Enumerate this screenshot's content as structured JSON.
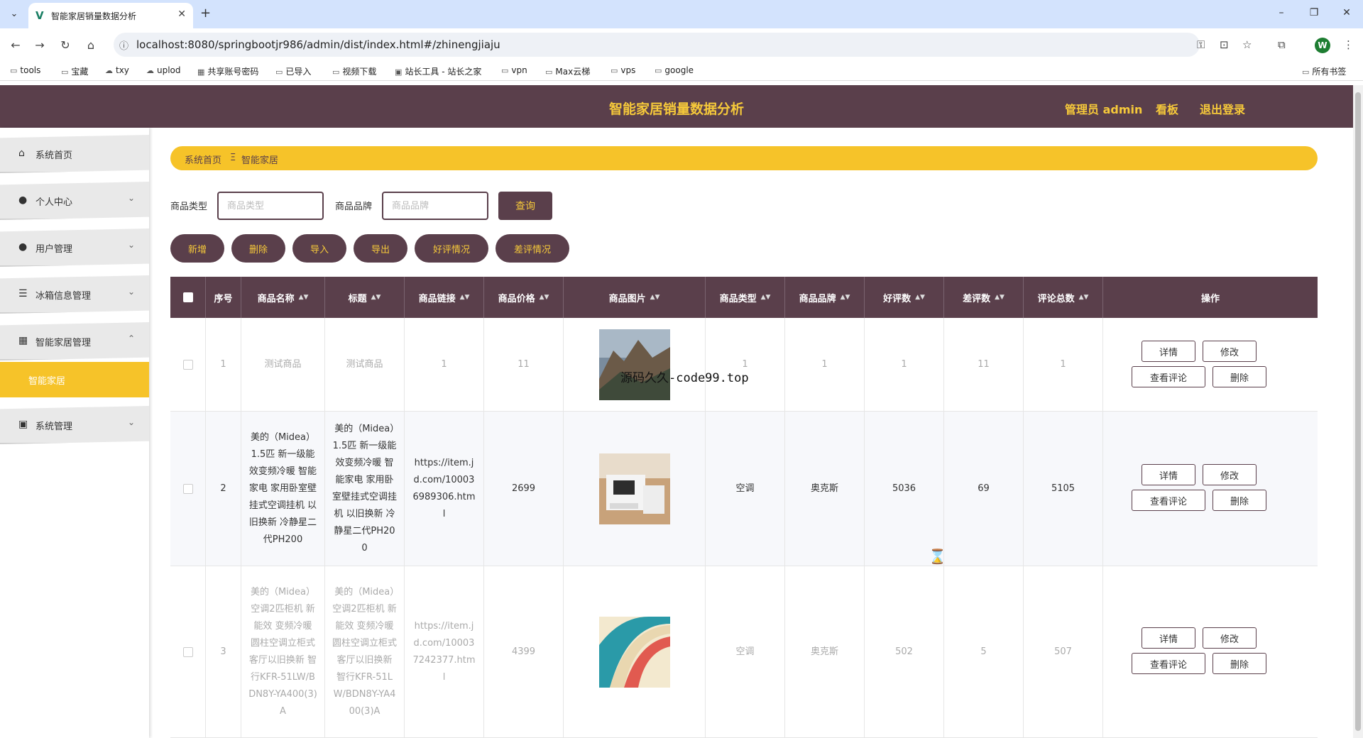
{
  "browser": {
    "tab_title": "智能家居销量数据分析",
    "url": "localhost:8080/springbootjr986/admin/dist/index.html#/zhinengjiaju",
    "profile_initial": "W",
    "bookmarks": [
      "tools",
      "宝藏",
      "txy",
      "uplod",
      "共享账号密码",
      "已导入",
      "视频下载",
      "站长工具 - 站长之家",
      "vpn",
      "Max云梯",
      "vps",
      "google"
    ],
    "all_bookmarks": "所有书签"
  },
  "header": {
    "title": "智能家居销量数据分析",
    "admin_label": "管理员 admin",
    "board_label": "看板",
    "logout_label": "退出登录"
  },
  "sidebar": {
    "items": [
      {
        "label": "系统首页"
      },
      {
        "label": "个人中心"
      },
      {
        "label": "用户管理"
      },
      {
        "label": "冰箱信息管理"
      },
      {
        "label": "智能家居管理"
      },
      {
        "label": "系统管理"
      }
    ],
    "active_sub": "智能家居"
  },
  "breadcrumb": {
    "home": "系统首页",
    "separator": "Ξ",
    "current": "智能家居"
  },
  "search": {
    "type_label": "商品类型",
    "type_placeholder": "商品类型",
    "brand_label": "商品品牌",
    "brand_placeholder": "商品品牌",
    "query_label": "查询"
  },
  "actions": [
    "新增",
    "删除",
    "导入",
    "导出",
    "好评情况",
    "差评情况"
  ],
  "table": {
    "columns": [
      "序号",
      "商品名称",
      "标题",
      "商品链接",
      "商品价格",
      "商品图片",
      "商品类型",
      "商品品牌",
      "好评数",
      "差评数",
      "评论总数",
      "操作"
    ],
    "rows": [
      {
        "index": "1",
        "name": "测试商品",
        "title": "测试商品",
        "link": "1",
        "price": "11",
        "type": "1",
        "brand": "1",
        "good": "1",
        "bad": "11",
        "total": "1"
      },
      {
        "index": "2",
        "name": "美的（Midea）1.5匹 新一级能效变频冷暖 智能家电 家用卧室壁挂式空调挂机 以旧换新 冷静星二代PH200",
        "title": "美的（Midea）1.5匹 新一级能效变频冷暖 智能家电 家用卧室壁挂式空调挂机 以旧换新 冷静星二代PH200",
        "link": "https://item.jd.com/100036989306.html",
        "price": "2699",
        "type": "空调",
        "brand": "奥克斯",
        "good": "5036",
        "bad": "69",
        "total": "5105"
      },
      {
        "index": "3",
        "name": "美的（Midea）空调2匹柜机 新能效 变频冷暖 圆柱空调立柜式 客厅以旧换新 智行KFR-51LW/BDN8Y-YA400(3)A",
        "title": "美的（Midea）空调2匹柜机 新能效 变频冷暖 圆柱空调立柜式 客厅以旧换新 智行KFR-51LW/BDN8Y-YA400(3)A",
        "link": "https://item.jd.com/100037242377.html",
        "price": "4399",
        "type": "空调",
        "brand": "奥克斯",
        "good": "502",
        "bad": "5",
        "total": "507"
      }
    ],
    "op_buttons": {
      "detail": "详情",
      "edit": "修改",
      "comments": "查看评论",
      "delete": "删除"
    }
  },
  "overlay_text": "源码久久-code99.top",
  "colors": {
    "primary": "#5a3f4b",
    "accent": "#f6c93a"
  }
}
